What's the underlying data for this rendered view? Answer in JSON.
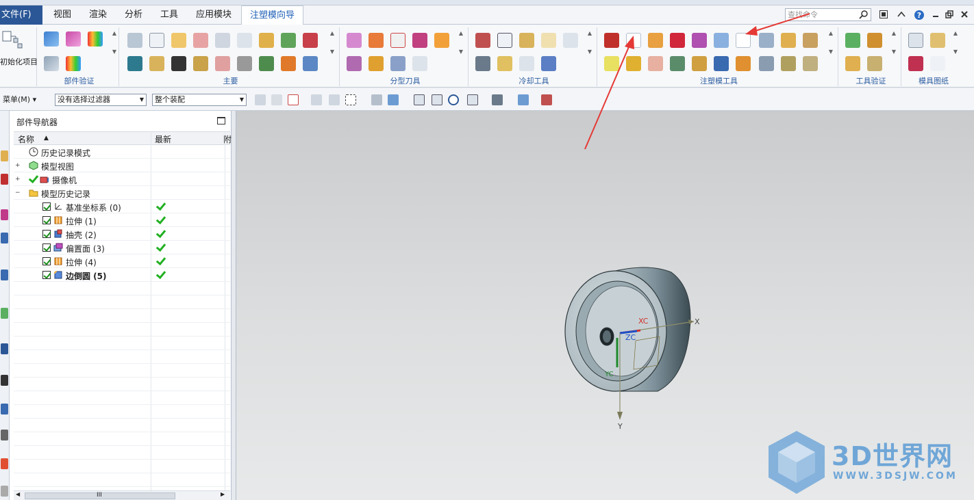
{
  "menu": {
    "file": "文件(F)",
    "tabs": [
      "视图",
      "渲染",
      "分析",
      "工具",
      "应用模块",
      "注塑模向导"
    ],
    "active_tab": "注塑模向导",
    "search_placeholder": "查找命令"
  },
  "ribbon": {
    "init_project_label": "初始化项目",
    "groups": [
      "部件验证",
      "主要",
      "分型刀具",
      "冷却工具",
      "注塑模工具",
      "工具验证",
      "模具图纸"
    ]
  },
  "toolbar2": {
    "menu_label": "菜单(M)",
    "filter_value": "没有选择过滤器",
    "assembly_value": "整个装配"
  },
  "navigator": {
    "title": "部件导航器",
    "columns": [
      "名称",
      "最新",
      "附"
    ],
    "items": [
      {
        "label": "历史记录模式",
        "level": 0,
        "checked": false,
        "latest": false,
        "bold": false
      },
      {
        "label": "模型视图",
        "level": 0,
        "checked": false,
        "latest": false,
        "bold": false
      },
      {
        "label": "摄像机",
        "level": 0,
        "checked": false,
        "latest": false,
        "bold": false
      },
      {
        "label": "模型历史记录",
        "level": 0,
        "checked": false,
        "latest": false,
        "bold": false
      },
      {
        "label": "基准坐标系 (0)",
        "level": 1,
        "checked": true,
        "latest": true,
        "bold": false
      },
      {
        "label": "拉伸 (1)",
        "level": 1,
        "checked": true,
        "latest": true,
        "bold": false
      },
      {
        "label": "抽壳 (2)",
        "level": 1,
        "checked": true,
        "latest": true,
        "bold": false
      },
      {
        "label": "偏置面 (3)",
        "level": 1,
        "checked": true,
        "latest": true,
        "bold": false
      },
      {
        "label": "拉伸 (4)",
        "level": 1,
        "checked": true,
        "latest": true,
        "bold": false
      },
      {
        "label": "边倒圆 (5)",
        "level": 1,
        "checked": true,
        "latest": true,
        "bold": true
      }
    ],
    "scroll_mark": "III"
  },
  "viewport": {
    "axis_x": "X",
    "axis_xc": "XC",
    "axis_zc": "ZC",
    "axis_yc": "YC",
    "axis_y": "Y"
  },
  "watermark": {
    "title": "3D世界网",
    "url": "WWW.3DSJW.COM"
  },
  "colors": {
    "file_tab": "#2b5797",
    "active_tab_text": "#1f5fb6",
    "arrow_red": "#e53935",
    "part_body": "#8a9ca6",
    "watermark": "#5b9bd5"
  }
}
